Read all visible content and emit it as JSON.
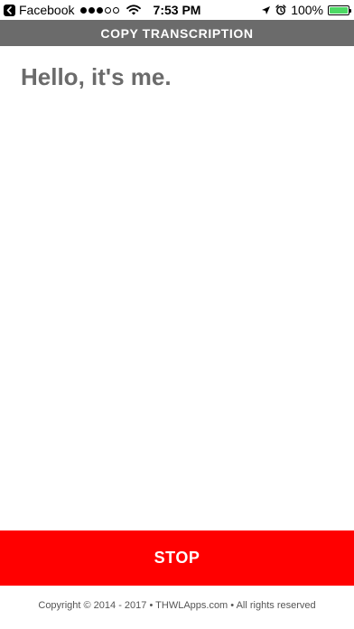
{
  "status_bar": {
    "back_app": "Facebook",
    "time": "7:53 PM",
    "battery": "100%",
    "battery_level": 1.0,
    "signal_bars_filled": 3,
    "signal_bars_total": 5,
    "icons": [
      "back-arrow-icon",
      "wifi-icon",
      "location-arrow-icon",
      "alarm-clock-icon",
      "battery-icon"
    ]
  },
  "header": {
    "title": "COPY TRANSCRIPTION"
  },
  "main": {
    "transcript_text": "Hello, it's me."
  },
  "actions": {
    "stop_label": "STOP"
  },
  "footer": {
    "copyright": "Copyright © 2014 - 2017 • THWLApps.com • All rights reserved"
  },
  "colors": {
    "header_bg": "#6b6b6b",
    "transcript_text": "#6b6b6b",
    "stop_bg": "#ff0000",
    "battery_fill": "#4cd964"
  }
}
